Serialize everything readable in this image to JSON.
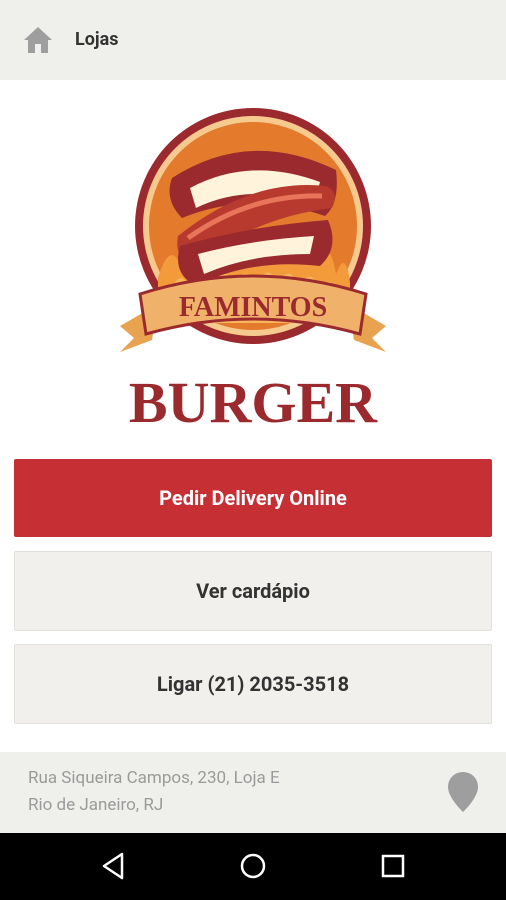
{
  "app_bar": {
    "title": "Lojas",
    "home_icon": "home-icon"
  },
  "logo": {
    "banner_text": "FAMINTOS",
    "brand_text": "BURGER"
  },
  "buttons": {
    "delivery": "Pedir Delivery Online",
    "menu": "Ver cardápio",
    "call": "Ligar (21) 2035-3518"
  },
  "address": {
    "line1": "Rua Siqueira Campos, 230, Loja E",
    "line2": "Rio de Janeiro, RJ",
    "pin_icon": "location-pin-icon"
  },
  "nav": {
    "back_icon": "back-triangle-icon",
    "home_icon": "home-circle-icon",
    "recents_icon": "recents-square-icon"
  },
  "colors": {
    "accent": "#c62f33",
    "brand_dark": "#9b2a2e",
    "logo_orange": "#e47a2c",
    "banner": "#f0b26a",
    "bar_bg": "#efefec"
  }
}
